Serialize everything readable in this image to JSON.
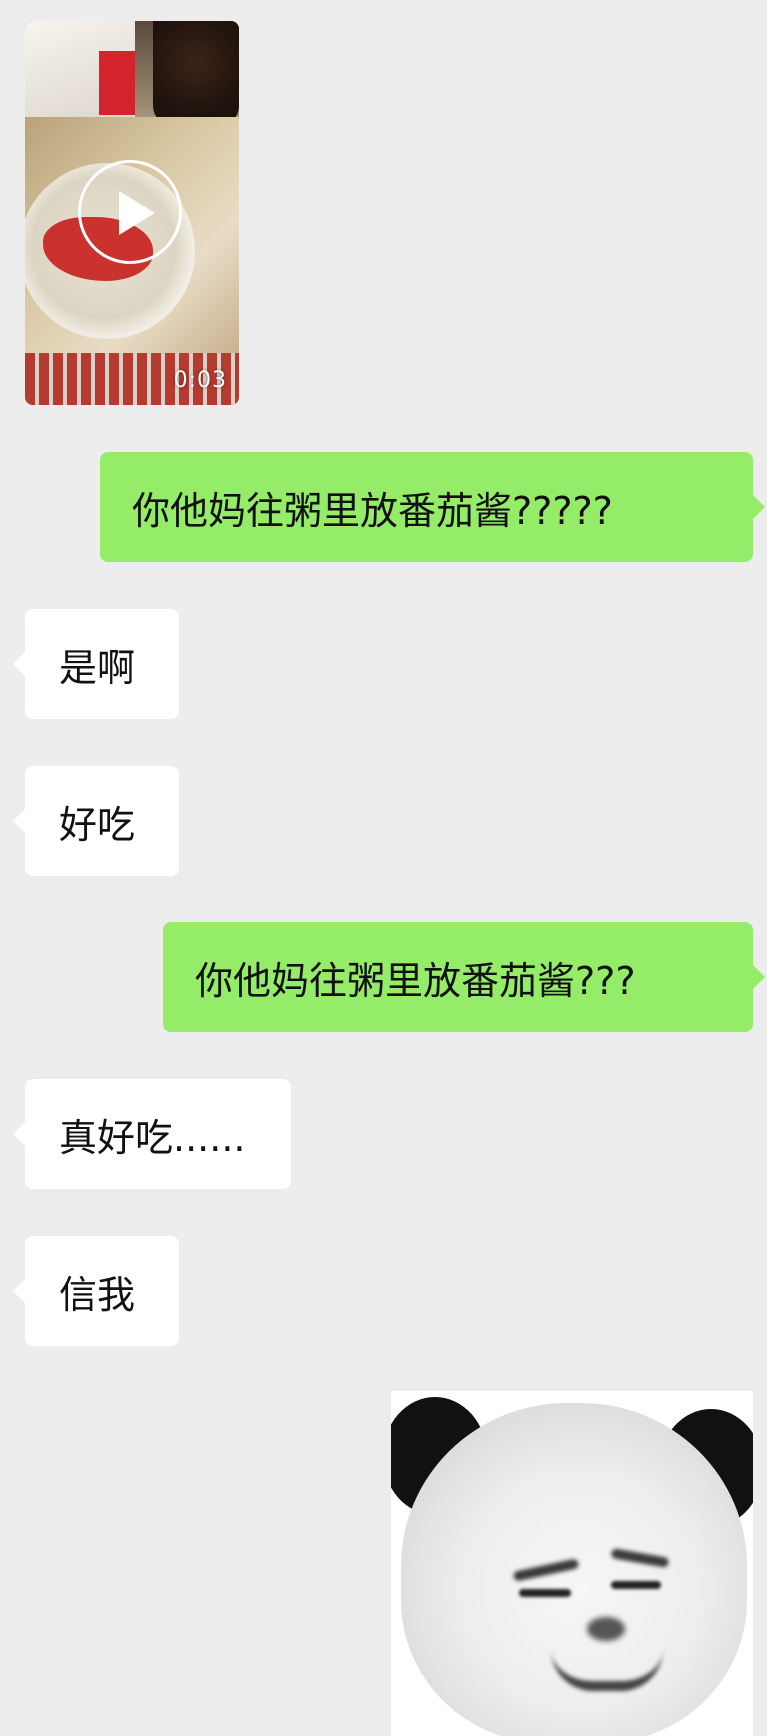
{
  "video_message": {
    "duration": "0:03",
    "play_icon": "play-icon"
  },
  "messages": [
    {
      "side": "right",
      "text": "你他妈往粥里放番茄酱?????"
    },
    {
      "side": "left",
      "text": "是啊"
    },
    {
      "side": "left",
      "text": "好吃"
    },
    {
      "side": "right",
      "text": "你他妈往粥里放番茄酱???"
    },
    {
      "side": "left",
      "text": "真好吃......"
    },
    {
      "side": "left",
      "text": "信我"
    }
  ],
  "sticker": {
    "icon": "panda-face-sticker"
  },
  "colors": {
    "background": "#ededed",
    "sent_bubble": "#95ec69",
    "received_bubble": "#ffffff"
  }
}
